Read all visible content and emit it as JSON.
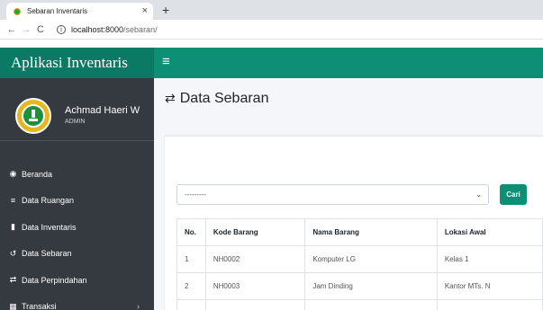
{
  "browser": {
    "tab_title": "Sebaran Inventaris",
    "tab_close": "×",
    "new_tab": "+",
    "back": "←",
    "forward": "→",
    "reload": "C",
    "info": "i",
    "url_host": "localhost:8000",
    "url_path": "/sebaran/"
  },
  "app": {
    "brand": "Aplikasi Inventaris",
    "menu_toggle": "≡"
  },
  "user": {
    "name": "Achmad Haeri W",
    "role": "ADMIN"
  },
  "sidebar": {
    "items": [
      {
        "icon": "tachometer-icon",
        "glyph": "◉",
        "label": "Beranda"
      },
      {
        "icon": "list-icon",
        "glyph": "≡",
        "label": "Data Ruangan"
      },
      {
        "icon": "file-icon",
        "glyph": "▮",
        "label": "Data Inventaris"
      },
      {
        "icon": "history-icon",
        "glyph": "↺",
        "label": "Data Sebaran"
      },
      {
        "icon": "exchange-icon",
        "glyph": "⇄",
        "label": "Data Perpindahan"
      },
      {
        "icon": "table-icon",
        "glyph": "▦",
        "label": "Transaksi",
        "chevron": "›"
      }
    ]
  },
  "page": {
    "title_icon": "⇄",
    "title": "Data Sebaran"
  },
  "filter": {
    "selected": "---------",
    "arrow": "⌄",
    "button": "Cari"
  },
  "table": {
    "headers": [
      "No.",
      "Kode Barang",
      "Nama Barang",
      "Lokasi Awal"
    ],
    "rows": [
      [
        "1",
        "NH0002",
        "Komputer LG",
        "Kelas 1"
      ],
      [
        "2",
        "NH0003",
        "Jam Dinding",
        "Kantor MTs. N"
      ]
    ]
  },
  "colors": {
    "primary": "#0d8f75",
    "sidebar": "#343a40",
    "content_bg": "#f4f6f9"
  }
}
